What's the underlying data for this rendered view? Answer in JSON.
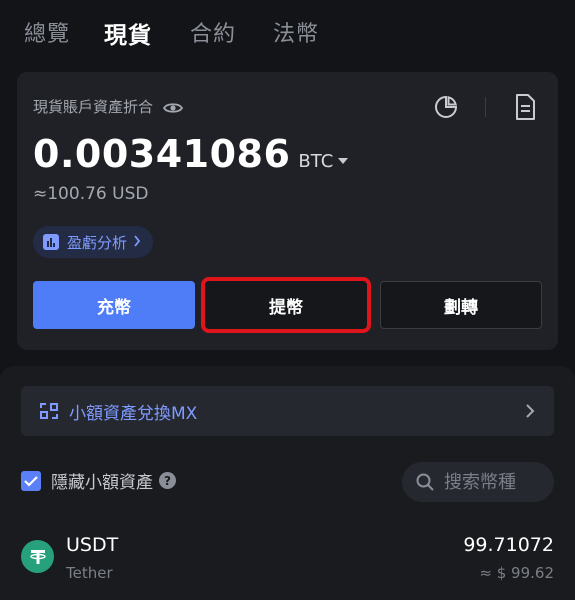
{
  "tabs": [
    {
      "label": "總覽",
      "active": false
    },
    {
      "label": "現貨",
      "active": true
    },
    {
      "label": "合約",
      "active": false
    },
    {
      "label": "法幣",
      "active": false
    }
  ],
  "spot": {
    "label": "現貨賬戶資產折合",
    "balance": "0.00341086",
    "unit": "BTC",
    "approx": "≈100.76 USD",
    "pnl_label": "盈虧分析"
  },
  "actions": {
    "deposit": "充幣",
    "withdraw": "提幣",
    "transfer": "劃轉"
  },
  "convert": {
    "label": "小額資產兌換MX"
  },
  "filter": {
    "hide_small_label": "隱藏小額資產",
    "hide_small_checked": true,
    "search_placeholder": "搜索幣種"
  },
  "assets": [
    {
      "symbol": "USDT",
      "name": "Tether",
      "amount": "99.71072",
      "value": "≈ $ 99.62"
    }
  ],
  "colors": {
    "accent": "#4f7df8",
    "highlight_border": "#e0151c",
    "tether": "#26a17b"
  },
  "icons": [
    "eye-icon",
    "pie-chart-icon",
    "document-icon",
    "bar-chart-icon",
    "chevron-right-icon",
    "convert-icon",
    "check-icon",
    "help-icon",
    "search-icon",
    "tether-icon"
  ]
}
